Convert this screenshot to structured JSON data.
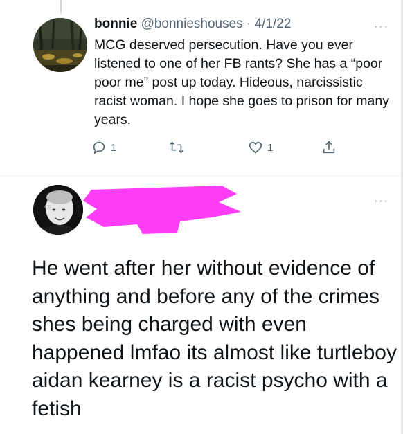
{
  "tweet1": {
    "display_name": "bonnie",
    "handle": "@bonnieshouses",
    "separator": "·",
    "date": "4/1/22",
    "more_label": "···",
    "text": "MCG deserved persecution. Have you ever listened to one of her FB rants? She has a “poor poor me” post up today. Hideous, narcissistic racist woman. I hope she goes to prison for many years.",
    "reply_count": "1",
    "retweet_count": "",
    "like_count": "1"
  },
  "tweet2": {
    "more_label": "···",
    "text": "He went after her without evidence of anything and before any of the crimes shes being charged with even happened lmfao its almost like turtleboy aidan kearney is a racist psycho with a fetish"
  },
  "colors": {
    "redaction": "#ff3df7",
    "text": "#0f1419",
    "muted": "#536471"
  }
}
